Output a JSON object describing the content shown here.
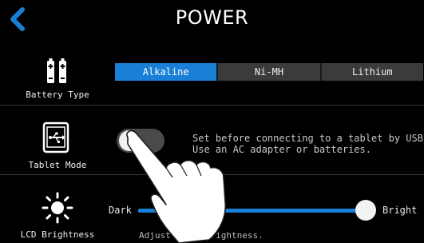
{
  "header": {
    "title": "POWER",
    "back_icon": "chevron-left-icon"
  },
  "battery_type": {
    "caption": "Battery Type",
    "icon": "battery-icon",
    "options": [
      "Alkaline",
      "Ni-MH",
      "Lithium"
    ],
    "selected": "Alkaline"
  },
  "tablet_mode": {
    "caption": "Tablet Mode",
    "icon": "usb-tablet-icon",
    "toggle_on": false,
    "note_line1": "Set before connecting to a tablet by USB.",
    "note_line2": "Use an AC adapter or batteries."
  },
  "lcd_brightness": {
    "caption": "LCD Brightness",
    "icon": "brightness-icon",
    "min_label": "Dark",
    "max_label": "Bright",
    "level": 1.0,
    "help_visible": "Adjust",
    "help_tail": "the brightness."
  },
  "overlay": {
    "icon": "tapping-hand-icon"
  },
  "colors": {
    "accent": "#1a7fd6",
    "background": "#000000",
    "segment": "#3b3b3b"
  }
}
